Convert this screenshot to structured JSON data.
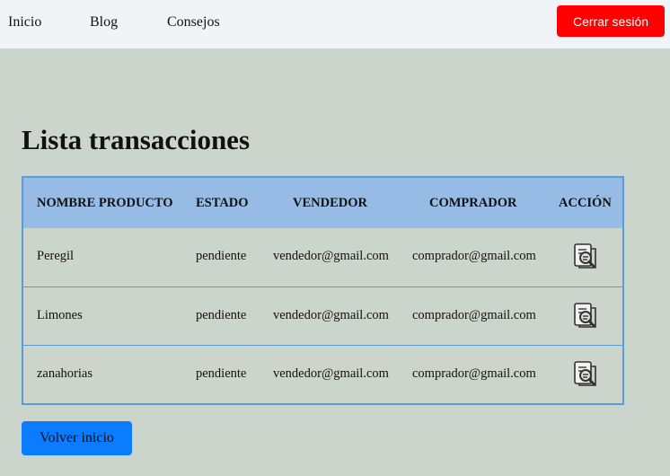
{
  "nav": {
    "links": [
      "Inicio",
      "Blog",
      "Consejos"
    ],
    "logout_label": "Cerrar sesión",
    "logout_color": "#ff0000"
  },
  "main": {
    "title": "Lista transacciones",
    "table": {
      "headers": [
        "NOMBRE PRODUCTO",
        "ESTADO",
        "VENDEDOR",
        "COMPRADOR",
        "ACCIÓN"
      ],
      "rows": [
        [
          "Peregil",
          "pendiente",
          "vendedor@gmail.com",
          "comprador@gmail.com"
        ],
        [
          "Limones",
          "pendiente",
          "vendedor@gmail.com",
          "comprador@gmail.com"
        ],
        [
          "zanahorias",
          "pendiente",
          "vendedor@gmail.com",
          "comprador@gmail.com"
        ]
      ],
      "action_icon": "search-document-icon",
      "header_color": "#96bce6",
      "border_color": "#5b9bd9"
    },
    "back_label": "Volver inicio",
    "back_color": "#0b7bff"
  }
}
